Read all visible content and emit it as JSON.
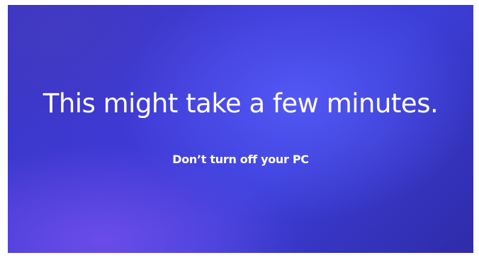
{
  "screen": {
    "title": "This might take a few minutes.",
    "subtitle": "Don’t turn off your PC",
    "background_color": "#3c3ed8",
    "text_color": "#ffffff"
  }
}
